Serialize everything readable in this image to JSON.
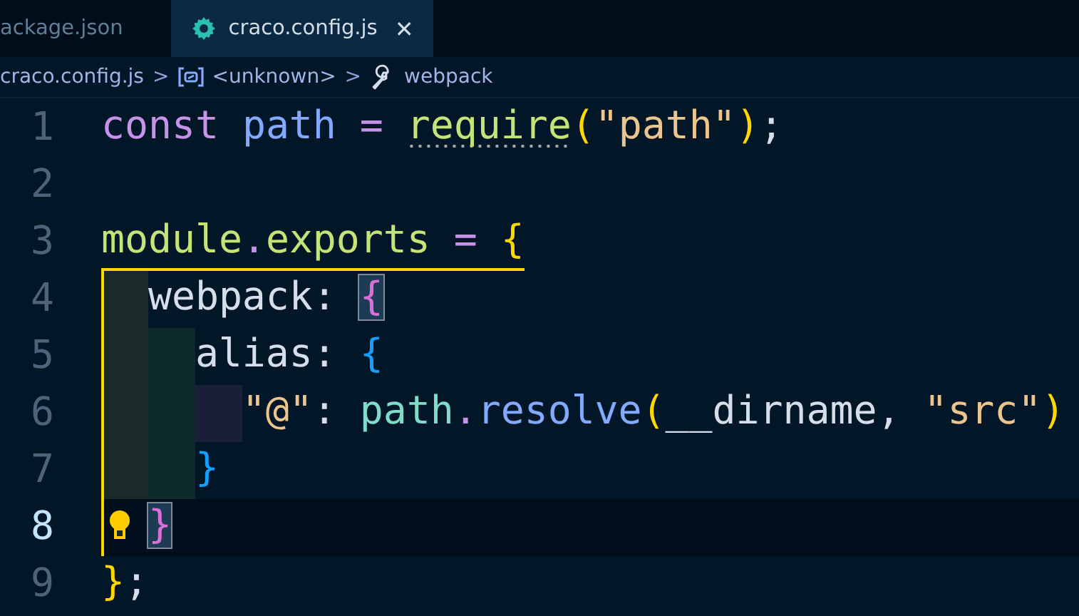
{
  "tabs": [
    {
      "label": "ackage.json",
      "selected": false
    },
    {
      "label": "craco.config.js",
      "selected": true,
      "close": "✕"
    }
  ],
  "breadcrumbs": [
    {
      "label": "craco.config.js"
    },
    {
      "label": "<unknown>"
    },
    {
      "label": "webpack"
    }
  ],
  "breadcrumb_separator": ">",
  "lines": [
    {
      "number": "1",
      "current": false,
      "tokens": [
        {
          "text": "const",
          "kind": "keyword"
        },
        {
          "text": "path",
          "kind": "variable",
          "spaced": true
        },
        {
          "text": "=",
          "kind": "operator",
          "spaced": true
        },
        {
          "text": "require",
          "kind": "function",
          "spaced": true,
          "hint": true
        },
        {
          "text": "(",
          "kind": "bracket1"
        },
        {
          "text": "\"path\"",
          "kind": "string"
        },
        {
          "text": ")",
          "kind": "bracket1"
        },
        {
          "text": ";",
          "kind": "plain"
        }
      ]
    },
    {
      "number": "2",
      "current": false
    },
    {
      "number": "3",
      "current": false,
      "active_scope": true,
      "tokens": [
        {
          "text": "module",
          "kind": "function"
        },
        {
          "text": ".",
          "kind": "operator"
        },
        {
          "text": "exports",
          "kind": "function"
        },
        {
          "text": "=",
          "kind": "operator",
          "spaced": true
        },
        {
          "text": "{",
          "kind": "bracket1",
          "spaced": true
        }
      ],
      "children": [
        {
          "number": "4",
          "current": false,
          "tokens": [
            {
              "text": "webpack:",
              "kind": "plain"
            },
            {
              "text": "{",
              "kind": "bracket2",
              "spaced": true,
              "matched": true
            }
          ],
          "children": [
            {
              "number": "5",
              "current": false,
              "tokens": [
                {
                  "text": "alias:",
                  "kind": "plain"
                },
                {
                  "text": "{",
                  "kind": "bracket3",
                  "spaced": true
                }
              ],
              "children": [
                {
                  "number": "6",
                  "current": false,
                  "tokens": [
                    {
                      "text": "\"@\"",
                      "kind": "string"
                    },
                    {
                      "text": ":",
                      "kind": "plain"
                    },
                    {
                      "text": "path",
                      "kind": "object",
                      "spaced": true
                    },
                    {
                      "text": ".",
                      "kind": "operator"
                    },
                    {
                      "text": "resolve",
                      "kind": "variable"
                    },
                    {
                      "text": "(",
                      "kind": "bracket1"
                    },
                    {
                      "text": "__dirname,",
                      "kind": "plain"
                    },
                    {
                      "text": "\"src\"",
                      "kind": "string",
                      "spaced": true
                    },
                    {
                      "text": ")",
                      "kind": "bracket1"
                    }
                  ]
                }
              ]
            },
            {
              "number": "7",
              "current": false,
              "tokens": [
                {
                  "text": "}",
                  "kind": "bracket3"
                }
              ]
            }
          ]
        },
        {
          "number": "8",
          "current": true,
          "lightbulb": true,
          "tokens": [
            {
              "text": "}",
              "kind": "bracket2",
              "matched": true
            }
          ]
        }
      ]
    },
    {
      "number": "9",
      "current": false,
      "tokens": [
        {
          "text": "}",
          "kind": "bracket1"
        },
        {
          "text": ";",
          "kind": "plain"
        }
      ]
    }
  ]
}
